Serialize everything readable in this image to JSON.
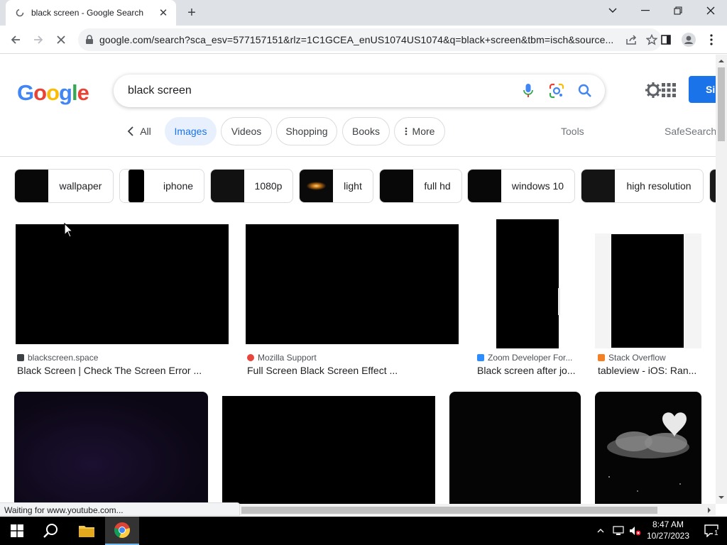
{
  "browser": {
    "tab_title": "black screen - Google Search",
    "address": "google.com/search?sca_esv=577157151&rlz=1C1GCEA_enUS1074US1074&q=black+screen&tbm=isch&source...",
    "status_text": "Waiting for www.youtube.com..."
  },
  "search": {
    "logo": "Google",
    "query": "black screen",
    "signin_label": "Si"
  },
  "filters": {
    "all": "All",
    "images": "Images",
    "videos": "Videos",
    "shopping": "Shopping",
    "books": "Books",
    "more": "More",
    "tools": "Tools",
    "safesearch": "SafeSearch"
  },
  "related": [
    {
      "label": "wallpaper"
    },
    {
      "label": "iphone"
    },
    {
      "label": "1080p"
    },
    {
      "label": "light"
    },
    {
      "label": "full hd"
    },
    {
      "label": "windows 10"
    },
    {
      "label": "high resolution"
    }
  ],
  "results": [
    {
      "source": "blackscreen.space",
      "title": "Black Screen | Check The Screen Error ...",
      "source_color": "#3c4043"
    },
    {
      "source": "Mozilla Support",
      "title": "Full Screen Black Screen Effect ...",
      "source_color": "#e8453c"
    },
    {
      "source": "Zoom Developer For...",
      "title": "Black screen after jo...",
      "source_color": "#2d8cff"
    },
    {
      "source": "Stack Overflow",
      "title": "tableview - iOS: Ran...",
      "source_color": "#f48024"
    }
  ],
  "taskbar": {
    "time": "8:47 AM",
    "date": "10/27/2023",
    "notification_count": "1"
  },
  "colors": {
    "accent": "#1a73e8",
    "active_chip_bg": "#e8f0fe",
    "taskbar": "#000000"
  }
}
